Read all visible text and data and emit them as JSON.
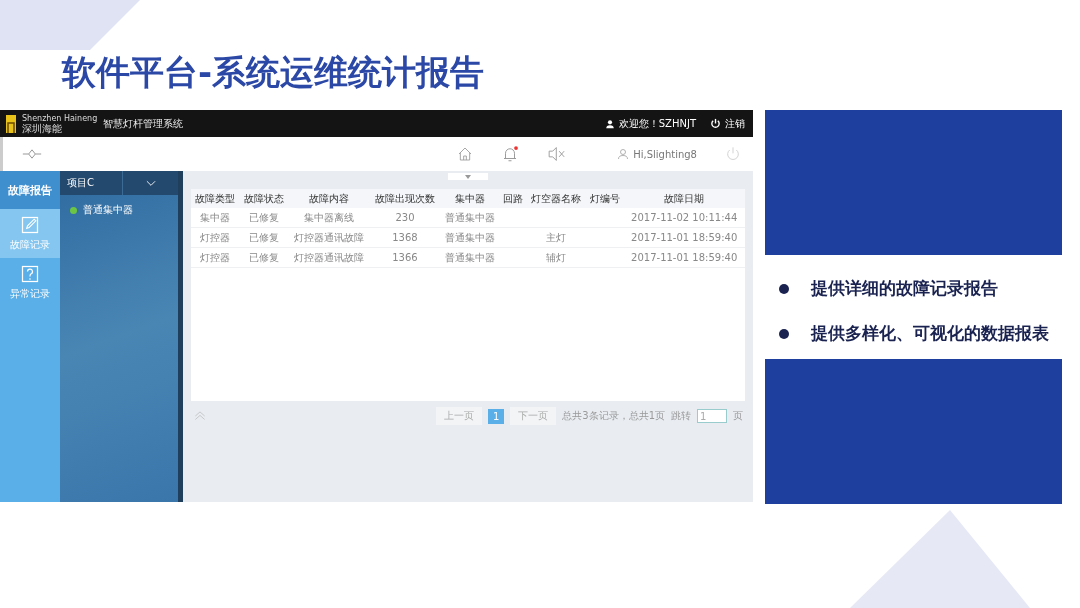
{
  "slide": {
    "title": "软件平台-系统运维统计报告",
    "bullets": [
      {
        "text": "提供详细的故障记录报告"
      },
      {
        "text": "提供多样化、可视化的数据报表"
      }
    ]
  },
  "app": {
    "brand_en": "Shenzhen Haineng",
    "brand_cn": "深圳海能",
    "app_title": "智慧灯杆管理系统",
    "welcome": "欢迎您！SZHNJT",
    "logout": "注销",
    "notification_unread": true,
    "user": "Hi,Slighting8",
    "nav": {
      "header": "故障报告",
      "items": [
        {
          "label": "故障记录",
          "kind": "edit",
          "selected": true
        },
        {
          "label": "异常记录",
          "kind": "question",
          "selected": false
        }
      ]
    },
    "project_select": {
      "value": "项目C"
    },
    "tree": [
      {
        "label": "普通集中器",
        "color": "#6cc644"
      }
    ],
    "table": {
      "columns": [
        "故障类型",
        "故障状态",
        "故障内容",
        "故障出现次数",
        "集中器",
        "回路",
        "灯空器名称",
        "灯编号",
        "故障日期"
      ],
      "rows": [
        [
          "集中器",
          "已修复",
          "集中器离线",
          "230",
          "普通集中器",
          null,
          null,
          null,
          "2017-11-02 10:11:44"
        ],
        [
          "灯控器",
          "已修复",
          "灯控器通讯故障",
          "1368",
          "普通集中器",
          null,
          "主灯",
          null,
          "2017-11-01 18:59:40"
        ],
        [
          "灯控器",
          "已修复",
          "灯控器通讯故障",
          "1366",
          "普通集中器",
          null,
          "辅灯",
          null,
          "2017-11-01 18:59:40"
        ]
      ]
    },
    "pagination": {
      "prev": "上一页",
      "pages": [
        {
          "label": "1",
          "selected": true
        }
      ],
      "next": "下一页",
      "summary": "总共3条记录，总共1页",
      "jump_label": "跳转",
      "jump_value": "1",
      "page_suffix": "页"
    }
  }
}
